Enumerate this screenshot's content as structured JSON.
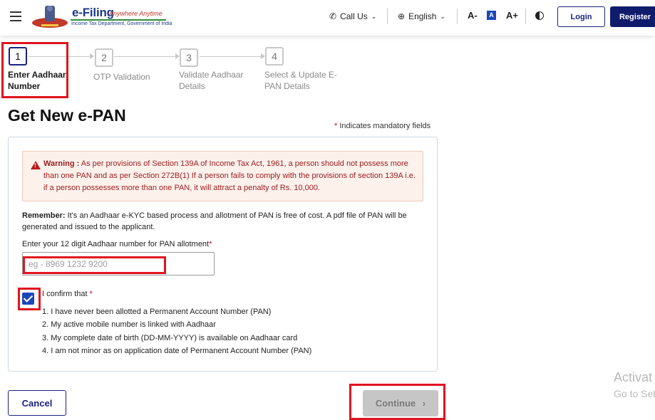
{
  "header": {
    "logo_title": "e-Filing",
    "logo_tagline": "Anywhere Anytime",
    "logo_subtitle": "Income Tax Department, Government of India",
    "call_us": "Call Us",
    "language": "English",
    "font_decrease": "A-",
    "font_normal": "A",
    "font_increase": "A+",
    "login": "Login",
    "register": "Register"
  },
  "stepper": {
    "current_step": 1,
    "steps": [
      {
        "number": "1",
        "label": "Enter Aadhaar Number"
      },
      {
        "number": "2",
        "label": "OTP Validation"
      },
      {
        "number": "3",
        "label": "Validate Aadhaar Details"
      },
      {
        "number": "4",
        "label": "Select & Update E-PAN Details"
      }
    ]
  },
  "page": {
    "title": "Get New e-PAN",
    "mandatory_star": "*",
    "mandatory_note": "Indicates mandatory fields"
  },
  "warning": {
    "heading": "Warning :",
    "text": "As per provisions of Section 139A of Income Tax Act, 1961, a person should not possess more than one PAN and as per Section 272B(1) If a person fails to comply with the provisions of section 139A i.e. if a person possesses more than one PAN, it will attract a penalty of Rs. 10,000."
  },
  "remember": {
    "heading": "Remember:",
    "text": "It's an Aadhaar e-KYC based process and allotment of PAN is free of cost. A pdf file of PAN will be generated and issued to the applicant."
  },
  "aadhaar_field": {
    "label": "Enter your 12 digit Aadhaar number for PAN allotment",
    "star": "*",
    "value": "",
    "placeholder": "eg - 8969 1232 9200"
  },
  "confirm": {
    "checked": true,
    "label": "I confirm that",
    "star": "*",
    "items": [
      "1. I have never been allotted a Permanent Account Number (PAN)",
      "2. My active mobile number is linked with Aadhaar",
      "3. My complete date of birth (DD-MM-YYYY) is available on Aadhaar card",
      "4. I am not minor as on application date of Permanent Account Number (PAN)"
    ]
  },
  "actions": {
    "cancel": "Cancel",
    "continue": "Continue",
    "continue_enabled": false
  },
  "watermark": {
    "line1": "Activat",
    "line2": "Go to Set"
  },
  "colors": {
    "brand_navy": "#1a237e",
    "highlight_red": "#e0141e",
    "warning_text": "#9a1b1b",
    "warning_bg": "#fdf1ec",
    "checkbox_blue": "#1a47b8"
  }
}
